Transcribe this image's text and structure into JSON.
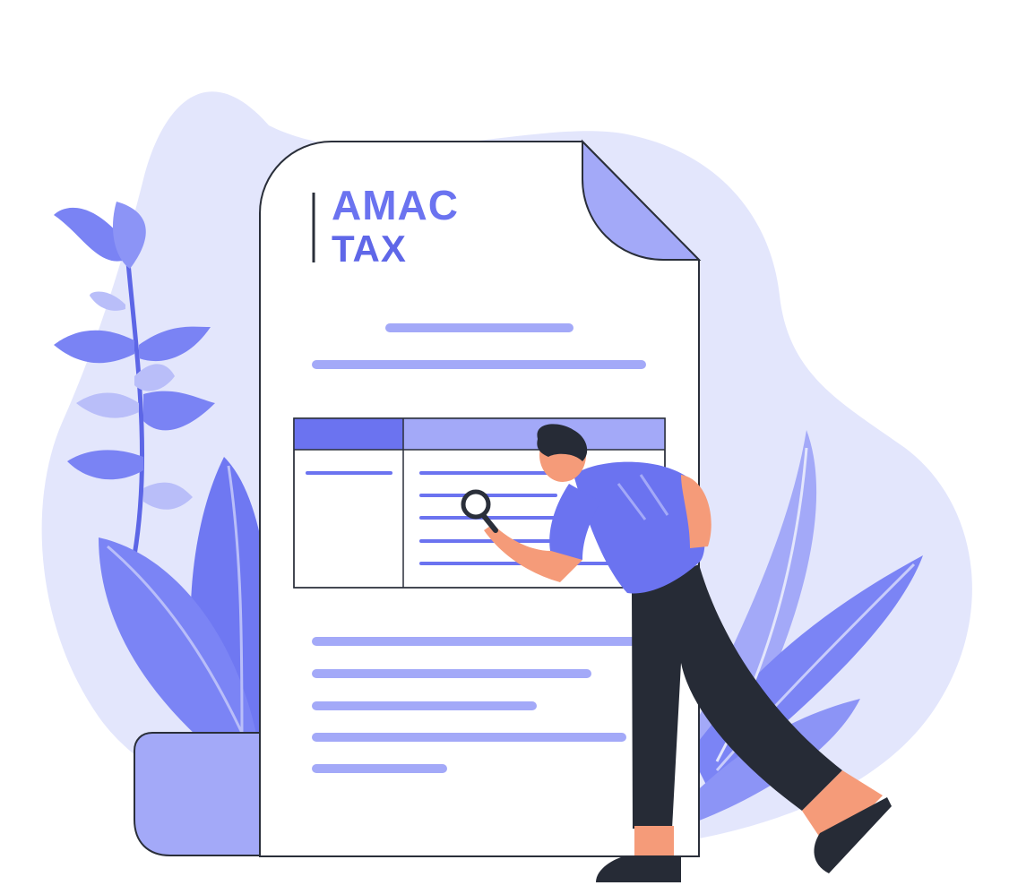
{
  "logo": {
    "line1": "AMAC",
    "line2": "TAX"
  },
  "colors": {
    "blob": "#e2e5fc",
    "paper": "#ffffff",
    "accent": "#6b73f0",
    "accent_light": "#a3a9f8",
    "leaf": "#7b84f5",
    "outline": "#2a2f3a",
    "skin": "#f59b79",
    "pants": "#262b36"
  },
  "icons": [
    "magnifying-glass-icon"
  ]
}
